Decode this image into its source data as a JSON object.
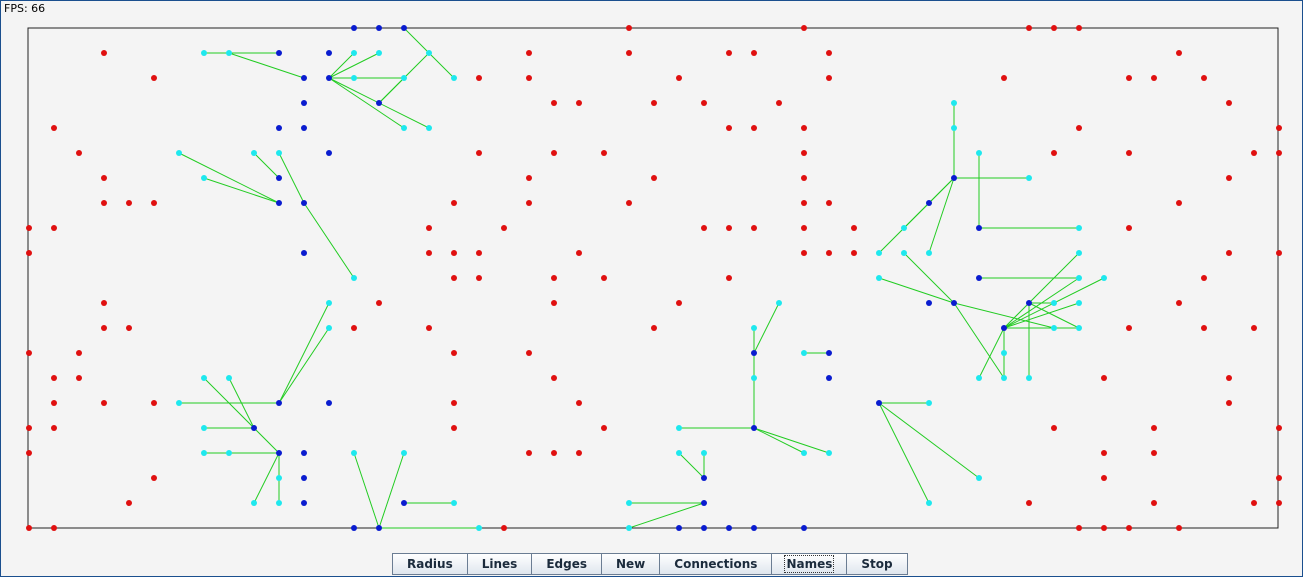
{
  "fps_text": "FPS: 66",
  "toolbar": {
    "buttons": [
      {
        "label": "Radius"
      },
      {
        "label": "Lines"
      },
      {
        "label": "Edges"
      },
      {
        "label": "New"
      },
      {
        "label": "Connections"
      },
      {
        "label": "Names",
        "selected": true
      },
      {
        "label": "Stop"
      }
    ]
  },
  "colors": {
    "red": "#e01010",
    "blue": "#0a1ccf",
    "cyan": "#1ee8ee",
    "line": "#22cc22",
    "border": "#222222",
    "background": "#f4f4f4"
  }
}
